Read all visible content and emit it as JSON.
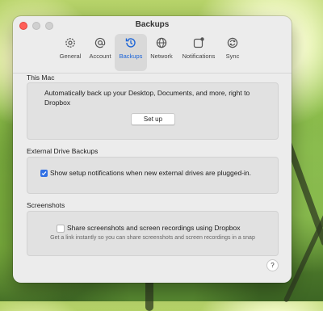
{
  "window": {
    "title": "Backups"
  },
  "toolbar": {
    "tabs": [
      {
        "label": "General",
        "icon": "gear-icon"
      },
      {
        "label": "Account",
        "icon": "at-sign-icon"
      },
      {
        "label": "Backups",
        "icon": "history-clock-icon",
        "active": true
      },
      {
        "label": "Network",
        "icon": "globe-icon"
      },
      {
        "label": "Notifications",
        "icon": "notification-badge-icon"
      },
      {
        "label": "Sync",
        "icon": "sync-icon"
      }
    ]
  },
  "this_mac": {
    "heading": "This Mac",
    "description": "Automatically back up your Desktop, Documents, and more, right to Dropbox",
    "button": "Set up"
  },
  "external_drive": {
    "heading": "External Drive Backups",
    "checkbox_label": "Show setup notifications when new external drives are plugged-in.",
    "checked": true
  },
  "screenshots": {
    "heading": "Screenshots",
    "checkbox_label": "Share screenshots and screen recordings using Dropbox",
    "checked": false,
    "hint": "Get a link instantly so you can share screenshots and screen recordings in a snap"
  },
  "help": {
    "label": "?"
  },
  "colors": {
    "accent": "#2f6fe4",
    "active_tab_text": "#1a63d8"
  }
}
